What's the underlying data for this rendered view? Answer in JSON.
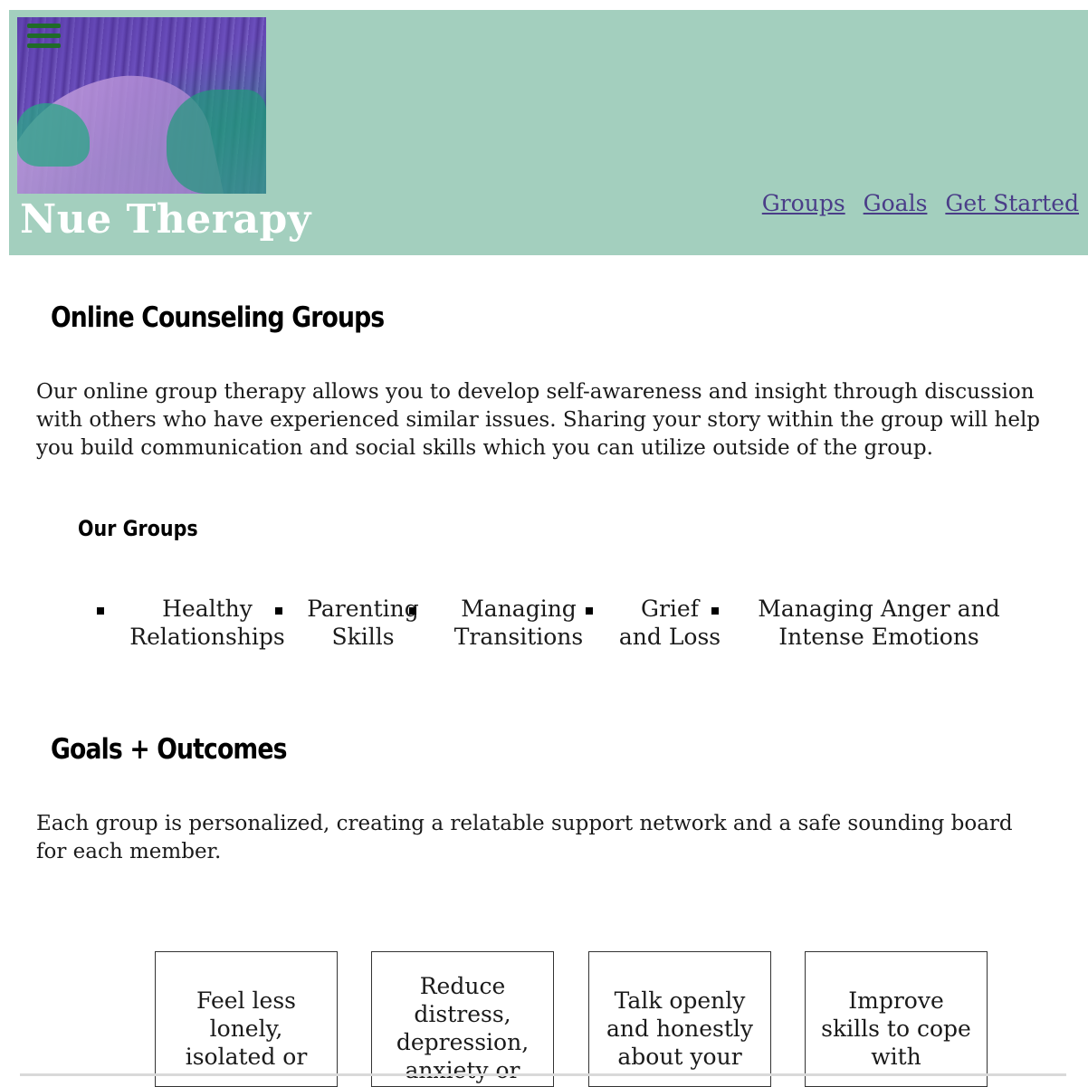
{
  "header": {
    "brand": "Nue Therapy",
    "nav": [
      "Groups",
      "Goals",
      "Get Started"
    ],
    "colors": {
      "header_bg": "#a3cfbe",
      "link": "#4a3d88",
      "menu_icon": "#1f6b28"
    }
  },
  "groups_section": {
    "title": "Online Counseling Groups",
    "description": "Our online group therapy allows you to develop self-awareness and insight through discussion with others who have experienced similar issues. Sharing your story within the group will help you build communication and social skills which you can utilize outside of the group.",
    "subtitle": "Our Groups",
    "items": [
      {
        "line1": "Healthy",
        "line2": "Relationships"
      },
      {
        "line1": "Parenting",
        "line2": "Skills"
      },
      {
        "line1": "Managing",
        "line2": "Transitions"
      },
      {
        "line1": "Grief",
        "line2": "and Loss"
      },
      {
        "line1": "Managing Anger and",
        "line2": "Intense Emotions"
      }
    ]
  },
  "goals_section": {
    "title": "Goals + Outcomes",
    "description": "Each group is personalized, creating a relatable support network and a safe sounding board for each member.",
    "cards": [
      {
        "lines": [
          "Feel less",
          "lonely,",
          "isolated or"
        ]
      },
      {
        "lines": [
          "Reduce",
          "distress,",
          "depression,",
          "anxiety or"
        ]
      },
      {
        "lines": [
          "Talk openly",
          "and honestly",
          "about your"
        ]
      },
      {
        "lines": [
          "Improve",
          "skills to cope",
          "with"
        ]
      }
    ]
  }
}
